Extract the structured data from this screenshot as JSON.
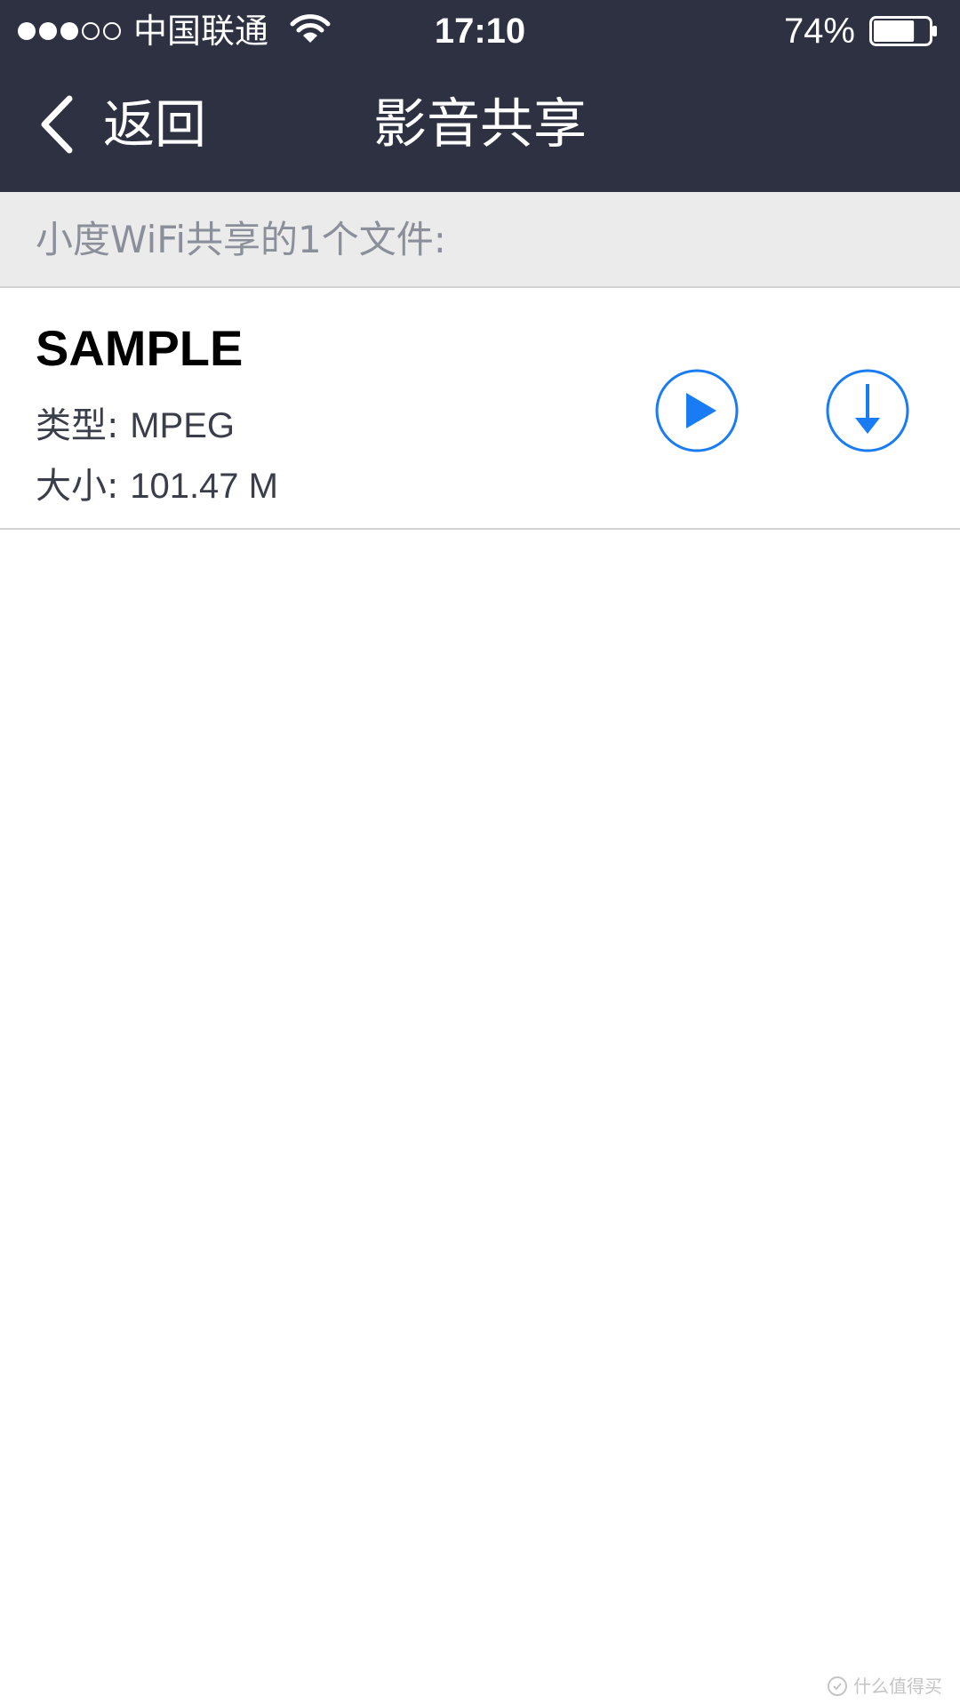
{
  "status_bar": {
    "signal_dots": [
      "full",
      "full",
      "full",
      "empty",
      "empty"
    ],
    "carrier": "中国联通",
    "wifi_icon": "wifi-icon",
    "time": "17:10",
    "battery_percent": "74%",
    "battery_level": 0.74
  },
  "nav": {
    "back_label": "返回",
    "back_icon": "chevron-left-icon",
    "title": "影音共享"
  },
  "section": {
    "header_text": "小度WiFi共享的1个文件:"
  },
  "files": [
    {
      "name": "SAMPLE",
      "type_label": "类型:",
      "type_value": "MPEG",
      "size_label": "大小:",
      "size_value": "101.47 M",
      "play_icon": "play-circle-icon",
      "download_icon": "download-circle-icon"
    }
  ],
  "watermark": {
    "text": "什么值得买"
  },
  "colors": {
    "nav_background": "#2e3142",
    "section_background": "#ebebeb",
    "accent": "#1a7cf5",
    "section_text": "#8a8f99"
  }
}
